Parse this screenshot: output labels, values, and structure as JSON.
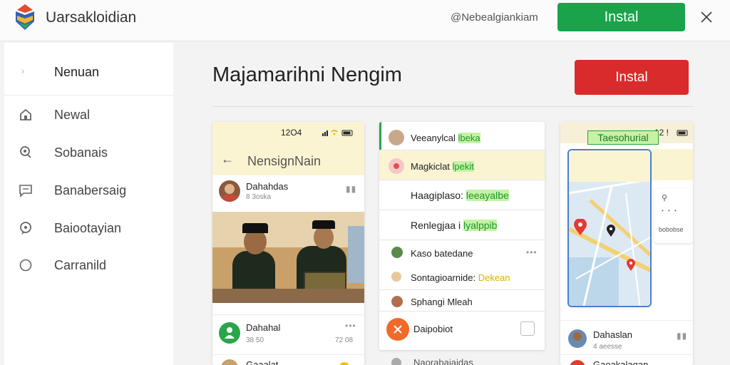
{
  "topbar": {
    "app_name": "Uarsakloidian",
    "subtitle": "@Nebealgiankiam",
    "install_label": "Instal"
  },
  "sidebar": {
    "header_label": "Nenuan",
    "items": [
      {
        "label": "Newal",
        "icon": "home-icon"
      },
      {
        "label": "Sobanais",
        "icon": "location-search-icon"
      },
      {
        "label": "Banabersaig",
        "icon": "chat-icon"
      },
      {
        "label": "Baiootayian",
        "icon": "message-bubble-icon"
      },
      {
        "label": "Carranild",
        "icon": "circle-icon"
      }
    ]
  },
  "main": {
    "title": "Majamarihni Nengim",
    "install_label": "Instal"
  },
  "card1": {
    "time": "12O4",
    "title": "NensignNain",
    "post1": {
      "name": "Dahahdas",
      "meta": "8 3oska"
    },
    "post2": {
      "name": "Dahahal",
      "meta": "38 50",
      "meta2": "72 08"
    },
    "post3": {
      "name": "Gaaalat"
    }
  },
  "card2": {
    "rows": [
      {
        "pre": "Veeanylcal",
        "hl": "lbeka"
      },
      {
        "pre": "Magkiclat",
        "hl": "lpekit"
      },
      {
        "pre": "Haagiplaso:",
        "hl": "leeayalbe"
      },
      {
        "pre": "Renlegjaa i",
        "hl": "lyalppib"
      },
      {
        "pre": "Kaso batedane"
      },
      {
        "pre": "Sontagioarnide:",
        "hl": "Dekean"
      },
      {
        "pre": "Sphangi Mleah"
      },
      {
        "pre": "Daipobiot"
      },
      {
        "pre": "Naorabaiaidas"
      }
    ]
  },
  "card3": {
    "time": "12 !",
    "map_label": "Taesohurial",
    "panel_text": "bobobse",
    "post1": {
      "name": "Dahaslan",
      "meta": "4 aeesse"
    },
    "post2": {
      "name": "Gaoakalagan"
    }
  },
  "colors": {
    "install_green": "#1aa34a",
    "install_red": "#d92b2b",
    "header_yellow": "#fbf4d3",
    "highlight_green": "#c6f2a5"
  }
}
